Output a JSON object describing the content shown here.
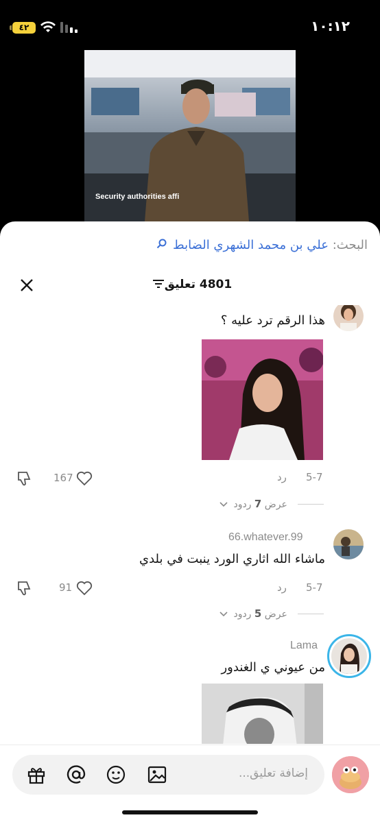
{
  "status": {
    "time": "١٠:١٢",
    "battery": "٤٢"
  },
  "video": {
    "caption": "Security authorities affi"
  },
  "search": {
    "label": "البحث:",
    "query": "علي بن محمد الشهري الضابط"
  },
  "header": {
    "count": "4801 تعليق"
  },
  "comments": [
    {
      "username": "",
      "text": "هذا الرقم ترد عليه ؟",
      "time": "5-7",
      "reply": "رد",
      "likes": "167",
      "view_replies_prefix": "عرض",
      "view_replies_count": "7",
      "view_replies_suffix": "ردود"
    },
    {
      "username": "66.whatever.99",
      "text": "ماشاء الله اثاري الورد ينبت في بلدي",
      "time": "5-7",
      "reply": "رد",
      "likes": "91",
      "view_replies_prefix": "عرض",
      "view_replies_count": "5",
      "view_replies_suffix": "ردود"
    },
    {
      "username": "Lama",
      "text": "من عيوني ي الغندور"
    }
  ],
  "input": {
    "placeholder": "إضافة تعليق..."
  },
  "colors": {
    "accent": "#3a6fd6",
    "muted": "#8a8a8a",
    "battery": "#f5d13b"
  }
}
